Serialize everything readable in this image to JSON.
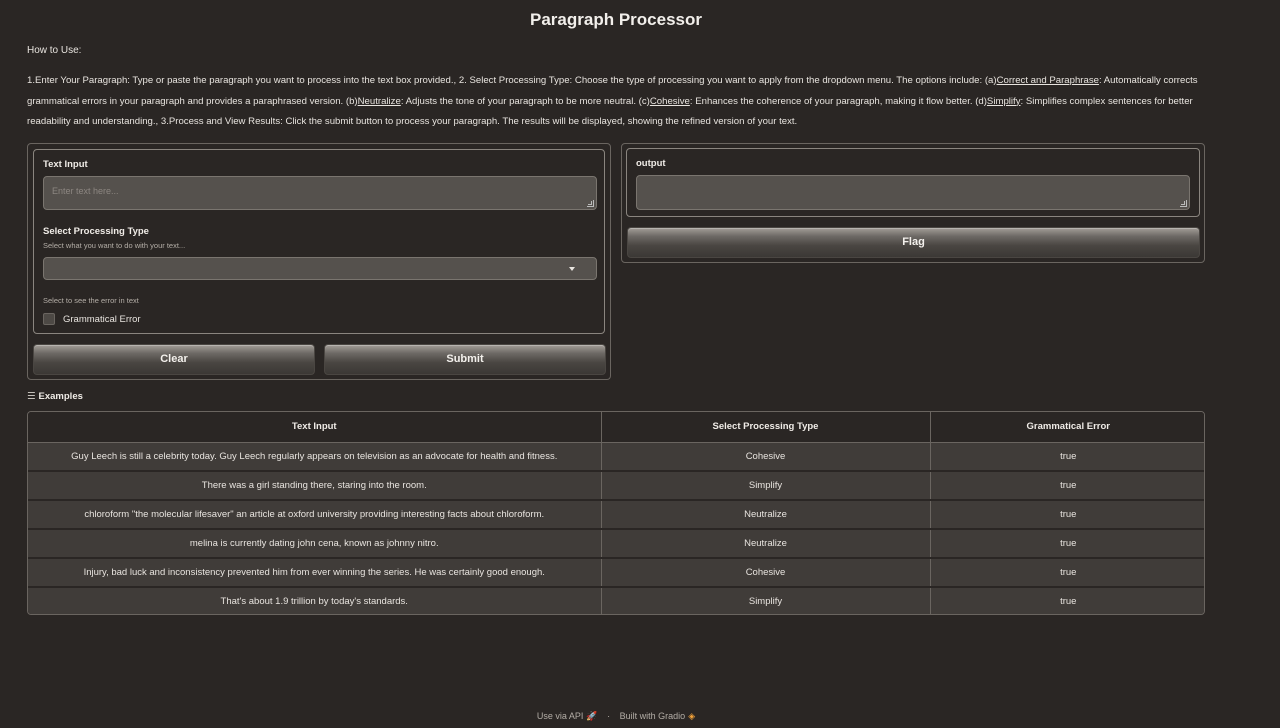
{
  "title": "Paragraph Processor",
  "howto": {
    "heading": "How to Use:",
    "line_parts": [
      "1.Enter Your Paragraph: Type or paste the paragraph you want to process into the text box provided., 2. Select Processing Type: Choose the type of processing you want to apply from the dropdown menu. The options include: (a)",
      "Correct and Paraphrase",
      ": Automatically corrects grammatical errors in your paragraph and provides a paraphrased version. (b)",
      "Neutralize",
      ": Adjusts the tone of your paragraph to be more neutral. (c)",
      "Cohesive",
      ": Enhances the coherence of your paragraph, making it flow better. (d)",
      "Simplify",
      ": Simplifies complex sentences for better readability and understanding., 3.Process and View Results: Click the submit button to process your paragraph. The results will be displayed, showing the refined version of your text."
    ]
  },
  "input_panel": {
    "text_label": "Text Input",
    "text_placeholder": "Enter text here...",
    "type_label": "Select Processing Type",
    "type_info": "Select what you want to do with your text...",
    "type_value": "",
    "error_info": "Select to see the error in text",
    "checkbox_label": "Grammatical Error",
    "checkbox_checked": false
  },
  "buttons": {
    "clear": "Clear",
    "submit": "Submit",
    "flag": "Flag"
  },
  "output_panel": {
    "label": "output",
    "value": ""
  },
  "examples": {
    "heading": "Examples",
    "headers": [
      "Text Input",
      "Select Processing Type",
      "Grammatical Error"
    ],
    "rows": [
      [
        "Guy Leech is still a celebrity today. Guy Leech regularly appears on television as an advocate for health and fitness.",
        "Cohesive",
        "true"
      ],
      [
        "There was a girl standing there, staring into the room.",
        "Simplify",
        "true"
      ],
      [
        "chloroform \"the molecular lifesaver\" an article at oxford university providing interesting facts about chloroform.",
        "Neutralize",
        "true"
      ],
      [
        "melina is currently dating john cena, known as johnny nitro.",
        "Neutralize",
        "true"
      ],
      [
        "Injury, bad luck and inconsistency prevented him from ever winning the series. He was certainly good enough.",
        "Cohesive",
        "true"
      ],
      [
        "That's about 1.9 trillion by today's standards.",
        "Simplify",
        "true"
      ]
    ]
  },
  "footer": {
    "api_link": "Use via API",
    "sep": "·",
    "built_with": "Built with Gradio"
  },
  "icons": {
    "rocket": "rocket-icon",
    "gradio": "gradio-logo-icon",
    "list": "list-icon",
    "chevron": "chevron-down-icon"
  }
}
